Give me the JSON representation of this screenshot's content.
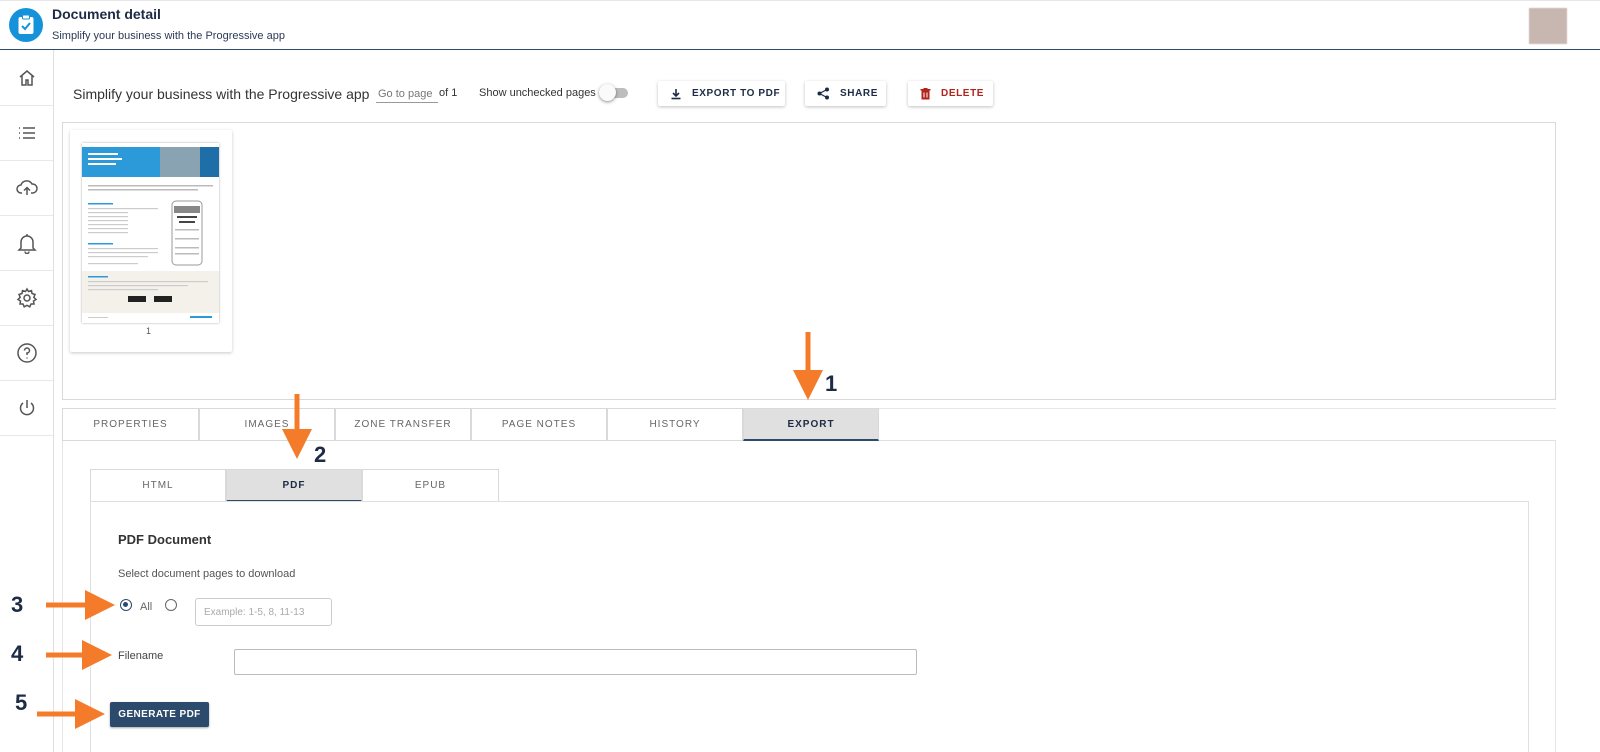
{
  "header": {
    "title": "Document detail",
    "subtitle": "Simplify your business with the Progressive app"
  },
  "sidebar": {
    "items": [
      {
        "icon": "home-icon"
      },
      {
        "icon": "list-icon"
      },
      {
        "icon": "cloud-upload-icon"
      },
      {
        "icon": "bell-icon"
      },
      {
        "icon": "gear-icon"
      },
      {
        "icon": "help-icon"
      },
      {
        "icon": "power-icon"
      }
    ]
  },
  "toolbar": {
    "doc_title": "Simplify your business with the Progressive app",
    "goto_placeholder": "Go to page",
    "page_of": "of 1",
    "show_unchecked_label": "Show unchecked pages",
    "export_pdf_label": "EXPORT TO PDF",
    "share_label": "SHARE",
    "delete_label": "DELETE"
  },
  "thumbnails": [
    {
      "page_number": "1"
    }
  ],
  "main_tabs": [
    {
      "label": "PROPERTIES",
      "active": false
    },
    {
      "label": "IMAGES",
      "active": false
    },
    {
      "label": "ZONE TRANSFER",
      "active": false
    },
    {
      "label": "PAGE NOTES",
      "active": false
    },
    {
      "label": "HISTORY",
      "active": false
    },
    {
      "label": "EXPORT",
      "active": true
    }
  ],
  "export": {
    "sub_tabs": [
      {
        "label": "HTML",
        "active": false
      },
      {
        "label": "PDF",
        "active": true
      },
      {
        "label": "EPUB",
        "active": false
      }
    ],
    "pdf": {
      "heading": "PDF Document",
      "select_label": "Select document pages to download",
      "radio_all_label": "All",
      "radio_all_selected": true,
      "range_placeholder": "Example: 1-5, 8, 11-13",
      "filename_label": "Filename",
      "filename_value": "",
      "generate_label": "GENERATE PDF"
    }
  },
  "annotations": {
    "step1": "1",
    "step2": "2",
    "step3": "3",
    "step4": "4",
    "step5": "5",
    "arrow_color": "#f47b2a"
  },
  "colors": {
    "accent": "#2c4a6b",
    "logo": "#1592d9",
    "delete": "#b3221b"
  }
}
